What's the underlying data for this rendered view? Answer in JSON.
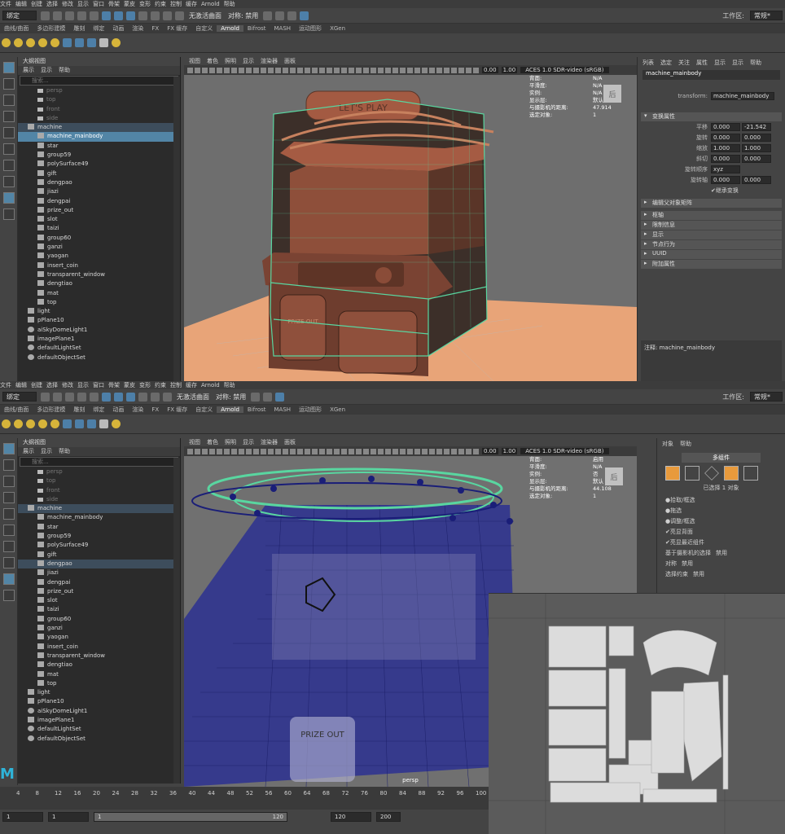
{
  "top": {
    "menu": [
      "文件",
      "编辑",
      "创建",
      "选择",
      "修改",
      "显示",
      "窗口",
      "骨架",
      "蒙皮",
      "变形",
      "约束",
      "控制",
      "缓存",
      "Arnold",
      "帮助"
    ],
    "workspace_label": "工作区:",
    "workspace_value": "常规*",
    "mode": "绑定",
    "live_surface": "无激活曲面",
    "symmetry": "对称: 禁用",
    "shelf_tabs": [
      "曲线/曲面",
      "多边形建模",
      "雕刻",
      "绑定",
      "动画",
      "渲染",
      "FX",
      "FX 缓存",
      "自定义",
      "Arnold",
      "Bifrost",
      "MASH",
      "运动图形",
      "XGen"
    ],
    "active_shelf": "Arnold",
    "outliner": {
      "title": "大纲视图",
      "menu": [
        "展示",
        "显示",
        "帮助"
      ],
      "search_placeholder": "搜索...",
      "items": [
        {
          "label": "persp",
          "type": "camera",
          "dim": true
        },
        {
          "label": "top",
          "type": "camera",
          "dim": true
        },
        {
          "label": "front",
          "type": "camera",
          "dim": true
        },
        {
          "label": "side",
          "type": "camera",
          "dim": true
        },
        {
          "label": "machine",
          "type": "group",
          "depth": 0,
          "hl": true
        },
        {
          "label": "machine_mainbody",
          "type": "mesh",
          "depth": 1,
          "sel": true
        },
        {
          "label": "star",
          "type": "mesh",
          "depth": 1
        },
        {
          "label": "group59",
          "type": "mesh",
          "depth": 1
        },
        {
          "label": "polySurface49",
          "type": "mesh",
          "depth": 1
        },
        {
          "label": "gift",
          "type": "mesh",
          "depth": 1
        },
        {
          "label": "dengpao",
          "type": "mesh",
          "depth": 1
        },
        {
          "label": "jiazi",
          "type": "mesh",
          "depth": 1
        },
        {
          "label": "dengpai",
          "type": "mesh",
          "depth": 1
        },
        {
          "label": "prize_out",
          "type": "mesh",
          "depth": 1
        },
        {
          "label": "slot",
          "type": "mesh",
          "depth": 1
        },
        {
          "label": "taizi",
          "type": "mesh",
          "depth": 1
        },
        {
          "label": "group60",
          "type": "mesh",
          "depth": 1
        },
        {
          "label": "ganzi",
          "type": "mesh",
          "depth": 1
        },
        {
          "label": "yaogan",
          "type": "mesh",
          "depth": 1
        },
        {
          "label": "insert_coin",
          "type": "mesh",
          "depth": 1
        },
        {
          "label": "transparent_window",
          "type": "mesh",
          "depth": 1
        },
        {
          "label": "dengtiao",
          "type": "mesh",
          "depth": 1
        },
        {
          "label": "mat",
          "type": "mesh",
          "depth": 1
        },
        {
          "label": "top",
          "type": "mesh",
          "depth": 1
        },
        {
          "label": "light",
          "type": "group",
          "depth": 0
        },
        {
          "label": "pPlane10",
          "type": "mesh",
          "depth": 0
        },
        {
          "label": "aiSkyDomeLight1",
          "type": "light",
          "depth": 0
        },
        {
          "label": "imagePlane1",
          "type": "mesh",
          "depth": 0
        },
        {
          "label": "defaultLightSet",
          "type": "set",
          "depth": 0
        },
        {
          "label": "defaultObjectSet",
          "type": "set",
          "depth": 0
        }
      ]
    },
    "viewport": {
      "menu": [
        "视图",
        "着色",
        "照明",
        "显示",
        "渲染器",
        "面板"
      ],
      "exposure": "0.00",
      "gamma": "1.00",
      "colorspace": "ACES 1.0 SDR-video (sRGB)",
      "hud": [
        {
          "k": "背面:",
          "v": "N/A"
        },
        {
          "k": "平滑度:",
          "v": "N/A"
        },
        {
          "k": "实例:",
          "v": "N/A"
        },
        {
          "k": "显示层:",
          "v": "默认"
        },
        {
          "k": "与摄影机的距离:",
          "v": "47.914"
        },
        {
          "k": "选定对象:",
          "v": "1"
        }
      ],
      "view_cube": "后"
    },
    "attr": {
      "tabs": [
        "列表",
        "选定",
        "关注",
        "属性",
        "显示",
        "显示",
        "帮助"
      ],
      "node_tab": "machine_mainbody",
      "transform_label": "transform:",
      "transform_value": "machine_mainbody",
      "section": "变换属性",
      "rows": [
        {
          "label": "平移",
          "x": "0.000",
          "y": "-21.542"
        },
        {
          "label": "旋转",
          "x": "0.000",
          "y": "0.000"
        },
        {
          "label": "缩放",
          "x": "1.000",
          "y": "1.000"
        },
        {
          "label": "斜切",
          "x": "0.000",
          "y": "0.000"
        }
      ],
      "rotate_order_label": "旋转顺序",
      "rotate_order": "xyz",
      "rotate_axis_label": "旋转轴",
      "rotate_axis": [
        "0.000",
        "0.000"
      ],
      "inherit": "继承变换",
      "pivot_section": "编辑父对象矩阵",
      "sections": [
        "枢轴",
        "限制信息",
        "显示",
        "节点行为",
        "UUID",
        "附加属性"
      ],
      "notes": "注释: machine_mainbody"
    }
  },
  "bottom": {
    "menu": [
      "文件",
      "编辑",
      "创建",
      "选择",
      "修改",
      "显示",
      "窗口",
      "骨架",
      "蒙皮",
      "变形",
      "约束",
      "控制",
      "缓存",
      "Arnold",
      "帮助"
    ],
    "workspace_label": "工作区:",
    "workspace_value": "常规*",
    "mode": "绑定",
    "live_surface": "无激活曲面",
    "symmetry": "对称: 禁用",
    "shelf_tabs": [
      "曲线/曲面",
      "多边形建模",
      "雕刻",
      "绑定",
      "动画",
      "渲染",
      "FX",
      "FX 缓存",
      "自定义",
      "Arnold",
      "Bifrost",
      "MASH",
      "运动图形",
      "XGen"
    ],
    "active_shelf": "Arnold",
    "outliner": {
      "title": "大纲视图",
      "menu": [
        "展示",
        "显示",
        "帮助"
      ],
      "search_placeholder": "搜索...",
      "items": [
        {
          "label": "persp",
          "type": "camera",
          "dim": true
        },
        {
          "label": "top",
          "type": "camera",
          "dim": true
        },
        {
          "label": "front",
          "type": "camera",
          "dim": true
        },
        {
          "label": "side",
          "type": "camera",
          "dim": true
        },
        {
          "label": "machine",
          "type": "group",
          "depth": 0,
          "hl": true
        },
        {
          "label": "machine_mainbody",
          "type": "mesh",
          "depth": 1
        },
        {
          "label": "star",
          "type": "mesh",
          "depth": 1
        },
        {
          "label": "group59",
          "type": "mesh",
          "depth": 1
        },
        {
          "label": "polySurface49",
          "type": "mesh",
          "depth": 1
        },
        {
          "label": "gift",
          "type": "mesh",
          "depth": 1
        },
        {
          "label": "dengpao",
          "type": "mesh",
          "depth": 1,
          "hl": true
        },
        {
          "label": "jiazi",
          "type": "mesh",
          "depth": 1
        },
        {
          "label": "dengpai",
          "type": "mesh",
          "depth": 1
        },
        {
          "label": "prize_out",
          "type": "mesh",
          "depth": 1
        },
        {
          "label": "slot",
          "type": "mesh",
          "depth": 1
        },
        {
          "label": "taizi",
          "type": "mesh",
          "depth": 1
        },
        {
          "label": "group60",
          "type": "mesh",
          "depth": 1
        },
        {
          "label": "ganzi",
          "type": "mesh",
          "depth": 1
        },
        {
          "label": "yaogan",
          "type": "mesh",
          "depth": 1
        },
        {
          "label": "insert_coin",
          "type": "mesh",
          "depth": 1
        },
        {
          "label": "transparent_window",
          "type": "mesh",
          "depth": 1
        },
        {
          "label": "dengtiao",
          "type": "mesh",
          "depth": 1
        },
        {
          "label": "mat",
          "type": "mesh",
          "depth": 1
        },
        {
          "label": "top",
          "type": "mesh",
          "depth": 1
        },
        {
          "label": "light",
          "type": "group",
          "depth": 0
        },
        {
          "label": "pPlane10",
          "type": "mesh",
          "depth": 0
        },
        {
          "label": "aiSkyDomeLight1",
          "type": "light",
          "depth": 0
        },
        {
          "label": "imagePlane1",
          "type": "mesh",
          "depth": 0
        },
        {
          "label": "defaultLightSet",
          "type": "set",
          "depth": 0
        },
        {
          "label": "defaultObjectSet",
          "type": "set",
          "depth": 0
        }
      ]
    },
    "viewport": {
      "menu": [
        "视图",
        "着色",
        "照明",
        "显示",
        "渲染器",
        "面板"
      ],
      "exposure": "0.00",
      "gamma": "1.00",
      "colorspace": "ACES 1.0 SDR-video (sRGB)",
      "hud": [
        {
          "k": "背面:",
          "v": "启用"
        },
        {
          "k": "平滑度:",
          "v": "N/A"
        },
        {
          "k": "实例:",
          "v": "否"
        },
        {
          "k": "显示层:",
          "v": "默认"
        },
        {
          "k": "与摄影机的距离:",
          "v": "44.108"
        },
        {
          "k": "选定对象:",
          "v": "1"
        }
      ],
      "view_cube": "后",
      "camera_label": "persp"
    },
    "modeling": {
      "menu": [
        "对象",
        "帮助"
      ],
      "mode": "多组件",
      "selected": "已选择 1 对象",
      "options": [
        "拾取/框选",
        "拖选",
        "调整/框选"
      ],
      "checks": [
        "亮显背面",
        "亮显最近组件"
      ],
      "camera_sel": "基于摄影机的选择",
      "camera_sel_val": "禁用",
      "symmetry": "对称",
      "symmetry_val": "禁用",
      "constraint": "选择约束",
      "constraint_val": "禁用"
    },
    "timeline": {
      "ticks": [
        "4",
        "8",
        "12",
        "16",
        "20",
        "24",
        "28",
        "32",
        "36",
        "40",
        "44",
        "48",
        "52",
        "56",
        "60",
        "64",
        "68",
        "72",
        "76",
        "80",
        "84",
        "88",
        "92",
        "96",
        "100"
      ],
      "start": "1",
      "current": "1",
      "range_start": "1",
      "range_end": "120",
      "end": "120",
      "anim_end": "200"
    }
  },
  "colors": {
    "accent": "#5285a6",
    "wire_green": "#59d6a0",
    "wire_blue": "#2a2e8a",
    "machine": "#a95f45"
  }
}
